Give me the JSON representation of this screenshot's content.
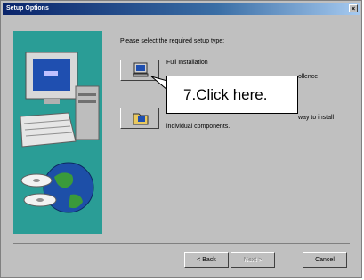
{
  "window": {
    "title": "Setup Options",
    "close_glyph": "×"
  },
  "prompt": "Please select the required setup type:",
  "options": [
    {
      "icon": "computer-install-icon",
      "label": "Full Installation",
      "desc_fragment": "ollence"
    },
    {
      "icon": "folder-install-icon",
      "label_fragment": "way to install",
      "desc": "individual components."
    }
  ],
  "callout": "7.Click here.",
  "buttons": {
    "back": "< Back",
    "next": "Next >",
    "cancel": "Cancel"
  },
  "colors": {
    "art_panel": "#2a9d96",
    "titlebar": "#0a246a"
  }
}
